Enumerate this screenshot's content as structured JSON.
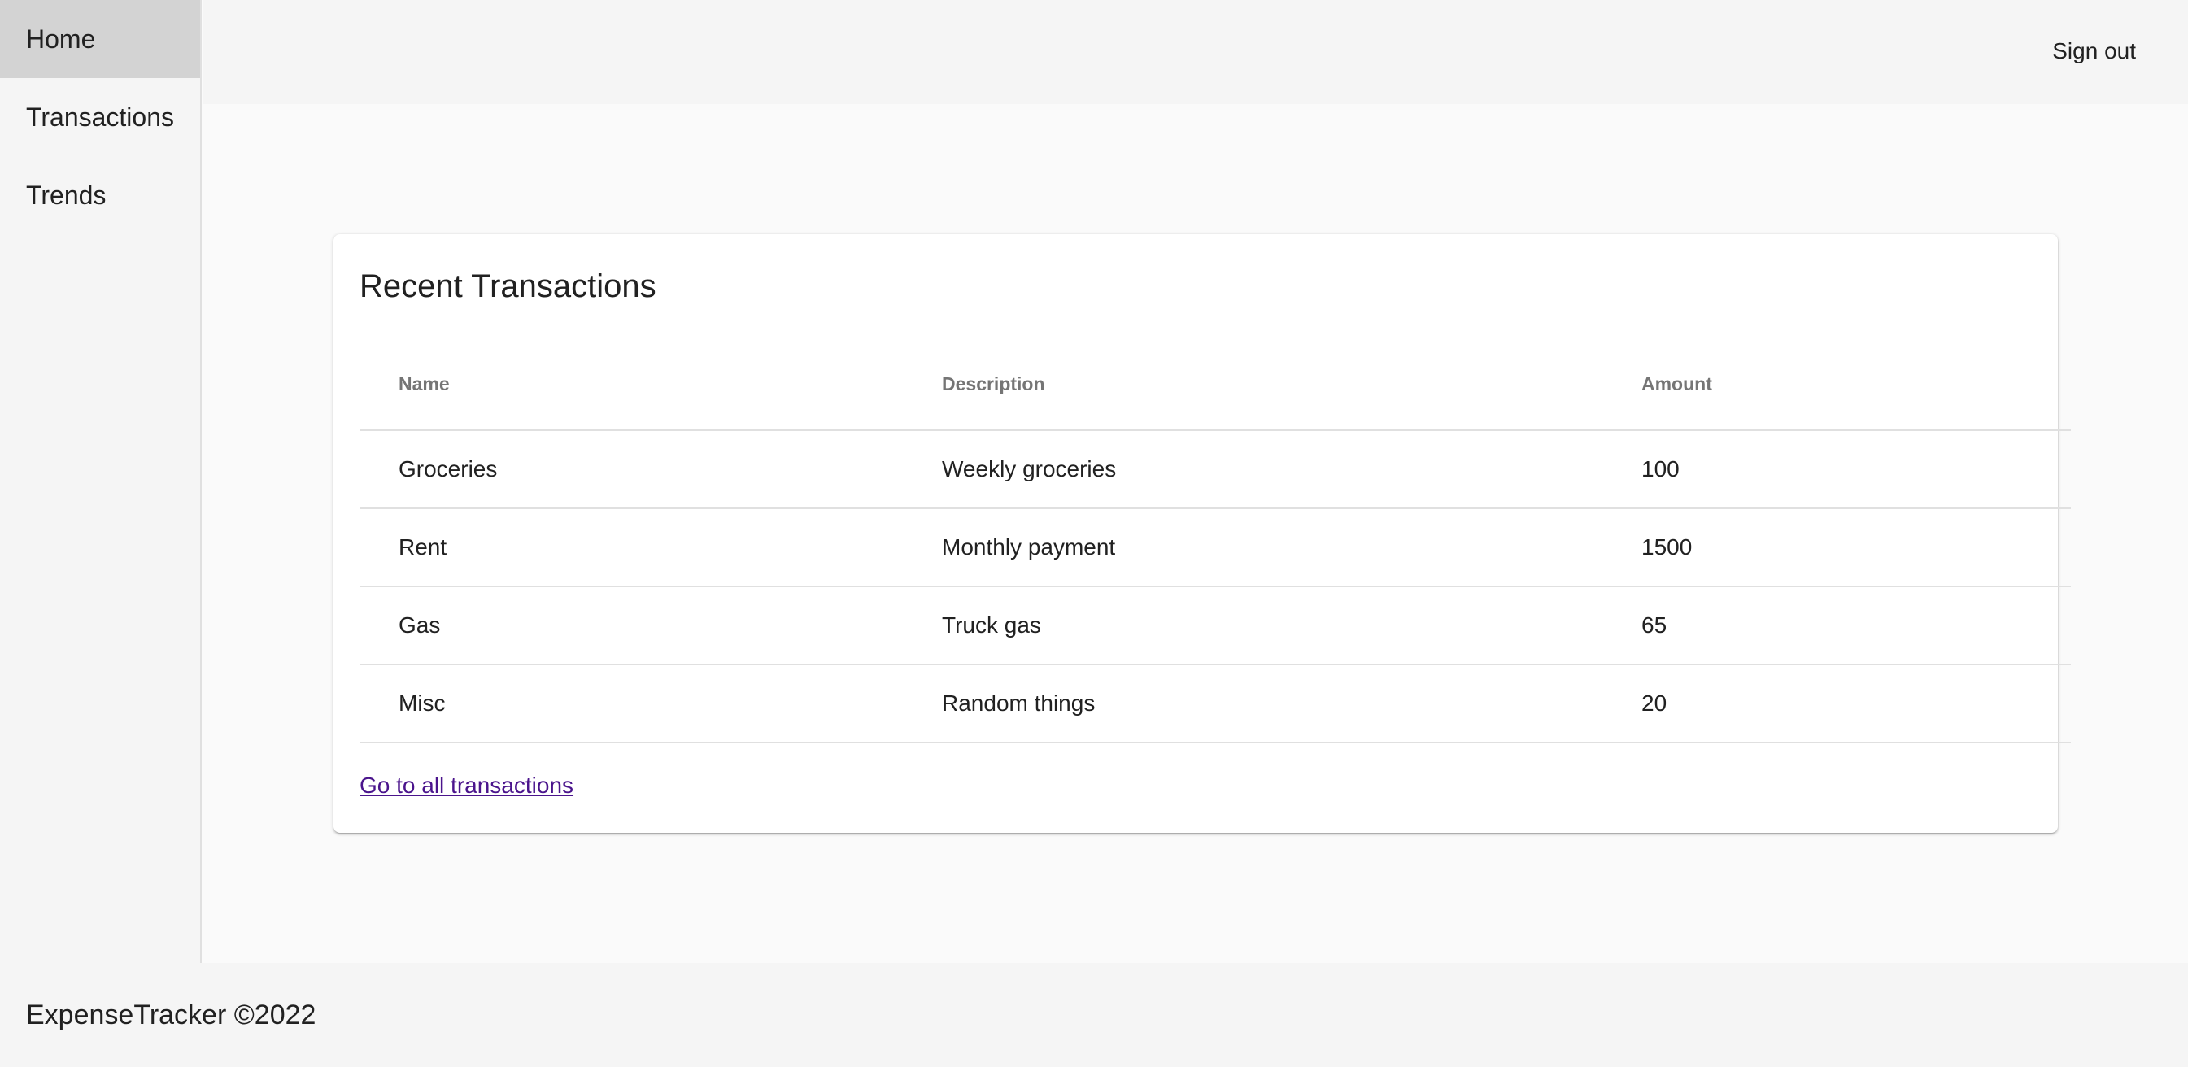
{
  "sidebar": {
    "items": [
      {
        "label": "Home",
        "active": true
      },
      {
        "label": "Transactions",
        "active": false
      },
      {
        "label": "Trends",
        "active": false
      }
    ]
  },
  "header": {
    "signout_label": "Sign out"
  },
  "recent": {
    "title": "Recent Transactions",
    "columns": [
      "Name",
      "Description",
      "Amount"
    ],
    "rows": [
      {
        "name": "Groceries",
        "description": "Weekly groceries",
        "amount": "100"
      },
      {
        "name": "Rent",
        "description": "Monthly payment",
        "amount": "1500"
      },
      {
        "name": "Gas",
        "description": "Truck gas",
        "amount": "65"
      },
      {
        "name": "Misc",
        "description": "Random things",
        "amount": "20"
      }
    ],
    "link_label": "Go to all transactions"
  },
  "footer": {
    "text": "ExpenseTracker ©2022"
  },
  "colors": {
    "sidebar_active": "#d3d3d3",
    "link": "#4a148c",
    "header_text": "#757575"
  }
}
